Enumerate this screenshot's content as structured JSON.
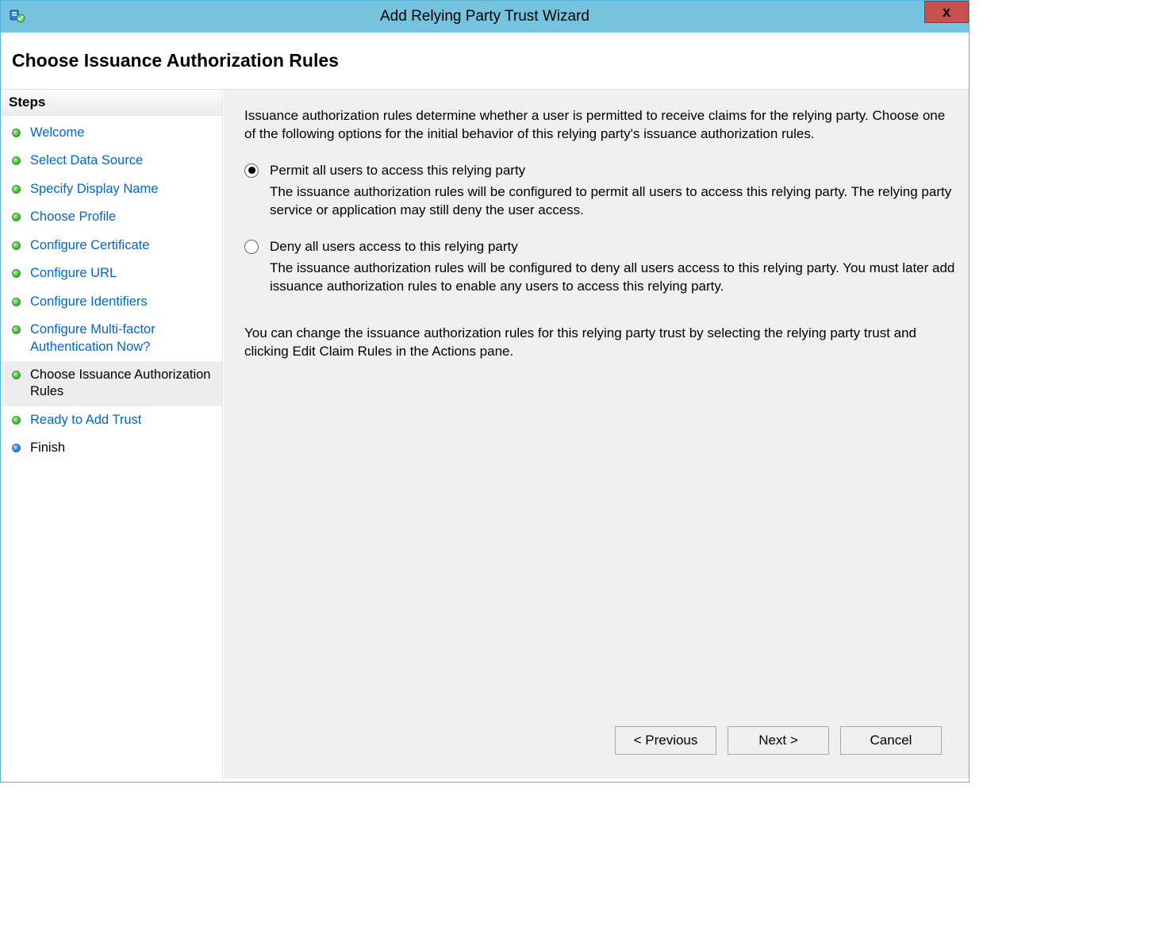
{
  "window": {
    "title": "Add Relying Party Trust Wizard"
  },
  "header": {
    "title": "Choose Issuance Authorization Rules"
  },
  "steps": {
    "header": "Steps",
    "items": [
      {
        "label": "Welcome",
        "bullet": "green",
        "state": "link"
      },
      {
        "label": "Select Data Source",
        "bullet": "green",
        "state": "link"
      },
      {
        "label": "Specify Display Name",
        "bullet": "green",
        "state": "link"
      },
      {
        "label": "Choose Profile",
        "bullet": "green",
        "state": "link"
      },
      {
        "label": "Configure Certificate",
        "bullet": "green",
        "state": "link"
      },
      {
        "label": "Configure URL",
        "bullet": "green",
        "state": "link"
      },
      {
        "label": "Configure Identifiers",
        "bullet": "green",
        "state": "link"
      },
      {
        "label": "Configure Multi-factor Authentication Now?",
        "bullet": "green",
        "state": "link"
      },
      {
        "label": "Choose Issuance Authorization Rules",
        "bullet": "green",
        "state": "current"
      },
      {
        "label": "Ready to Add Trust",
        "bullet": "green",
        "state": "link"
      },
      {
        "label": "Finish",
        "bullet": "blue",
        "state": "plain"
      }
    ]
  },
  "content": {
    "intro": "Issuance authorization rules determine whether a user is permitted to receive claims for the relying party. Choose one of the following options for the initial behavior of this relying party's issuance authorization rules.",
    "options": [
      {
        "label": "Permit all users to access this relying party",
        "desc": "The issuance authorization rules will be configured to permit all users to access this relying party. The relying party service or application may still deny the user access.",
        "selected": true
      },
      {
        "label": "Deny all users access to this relying party",
        "desc": "The issuance authorization rules will be configured to deny all users access to this relying party. You must later add issuance authorization rules to enable any users to access this relying party.",
        "selected": false
      }
    ],
    "footnote": "You can change the issuance authorization rules for this relying party trust by selecting the relying party trust and clicking Edit Claim Rules in the Actions pane."
  },
  "buttons": {
    "previous": "< Previous",
    "next": "Next >",
    "cancel": "Cancel"
  },
  "close_glyph": "x"
}
